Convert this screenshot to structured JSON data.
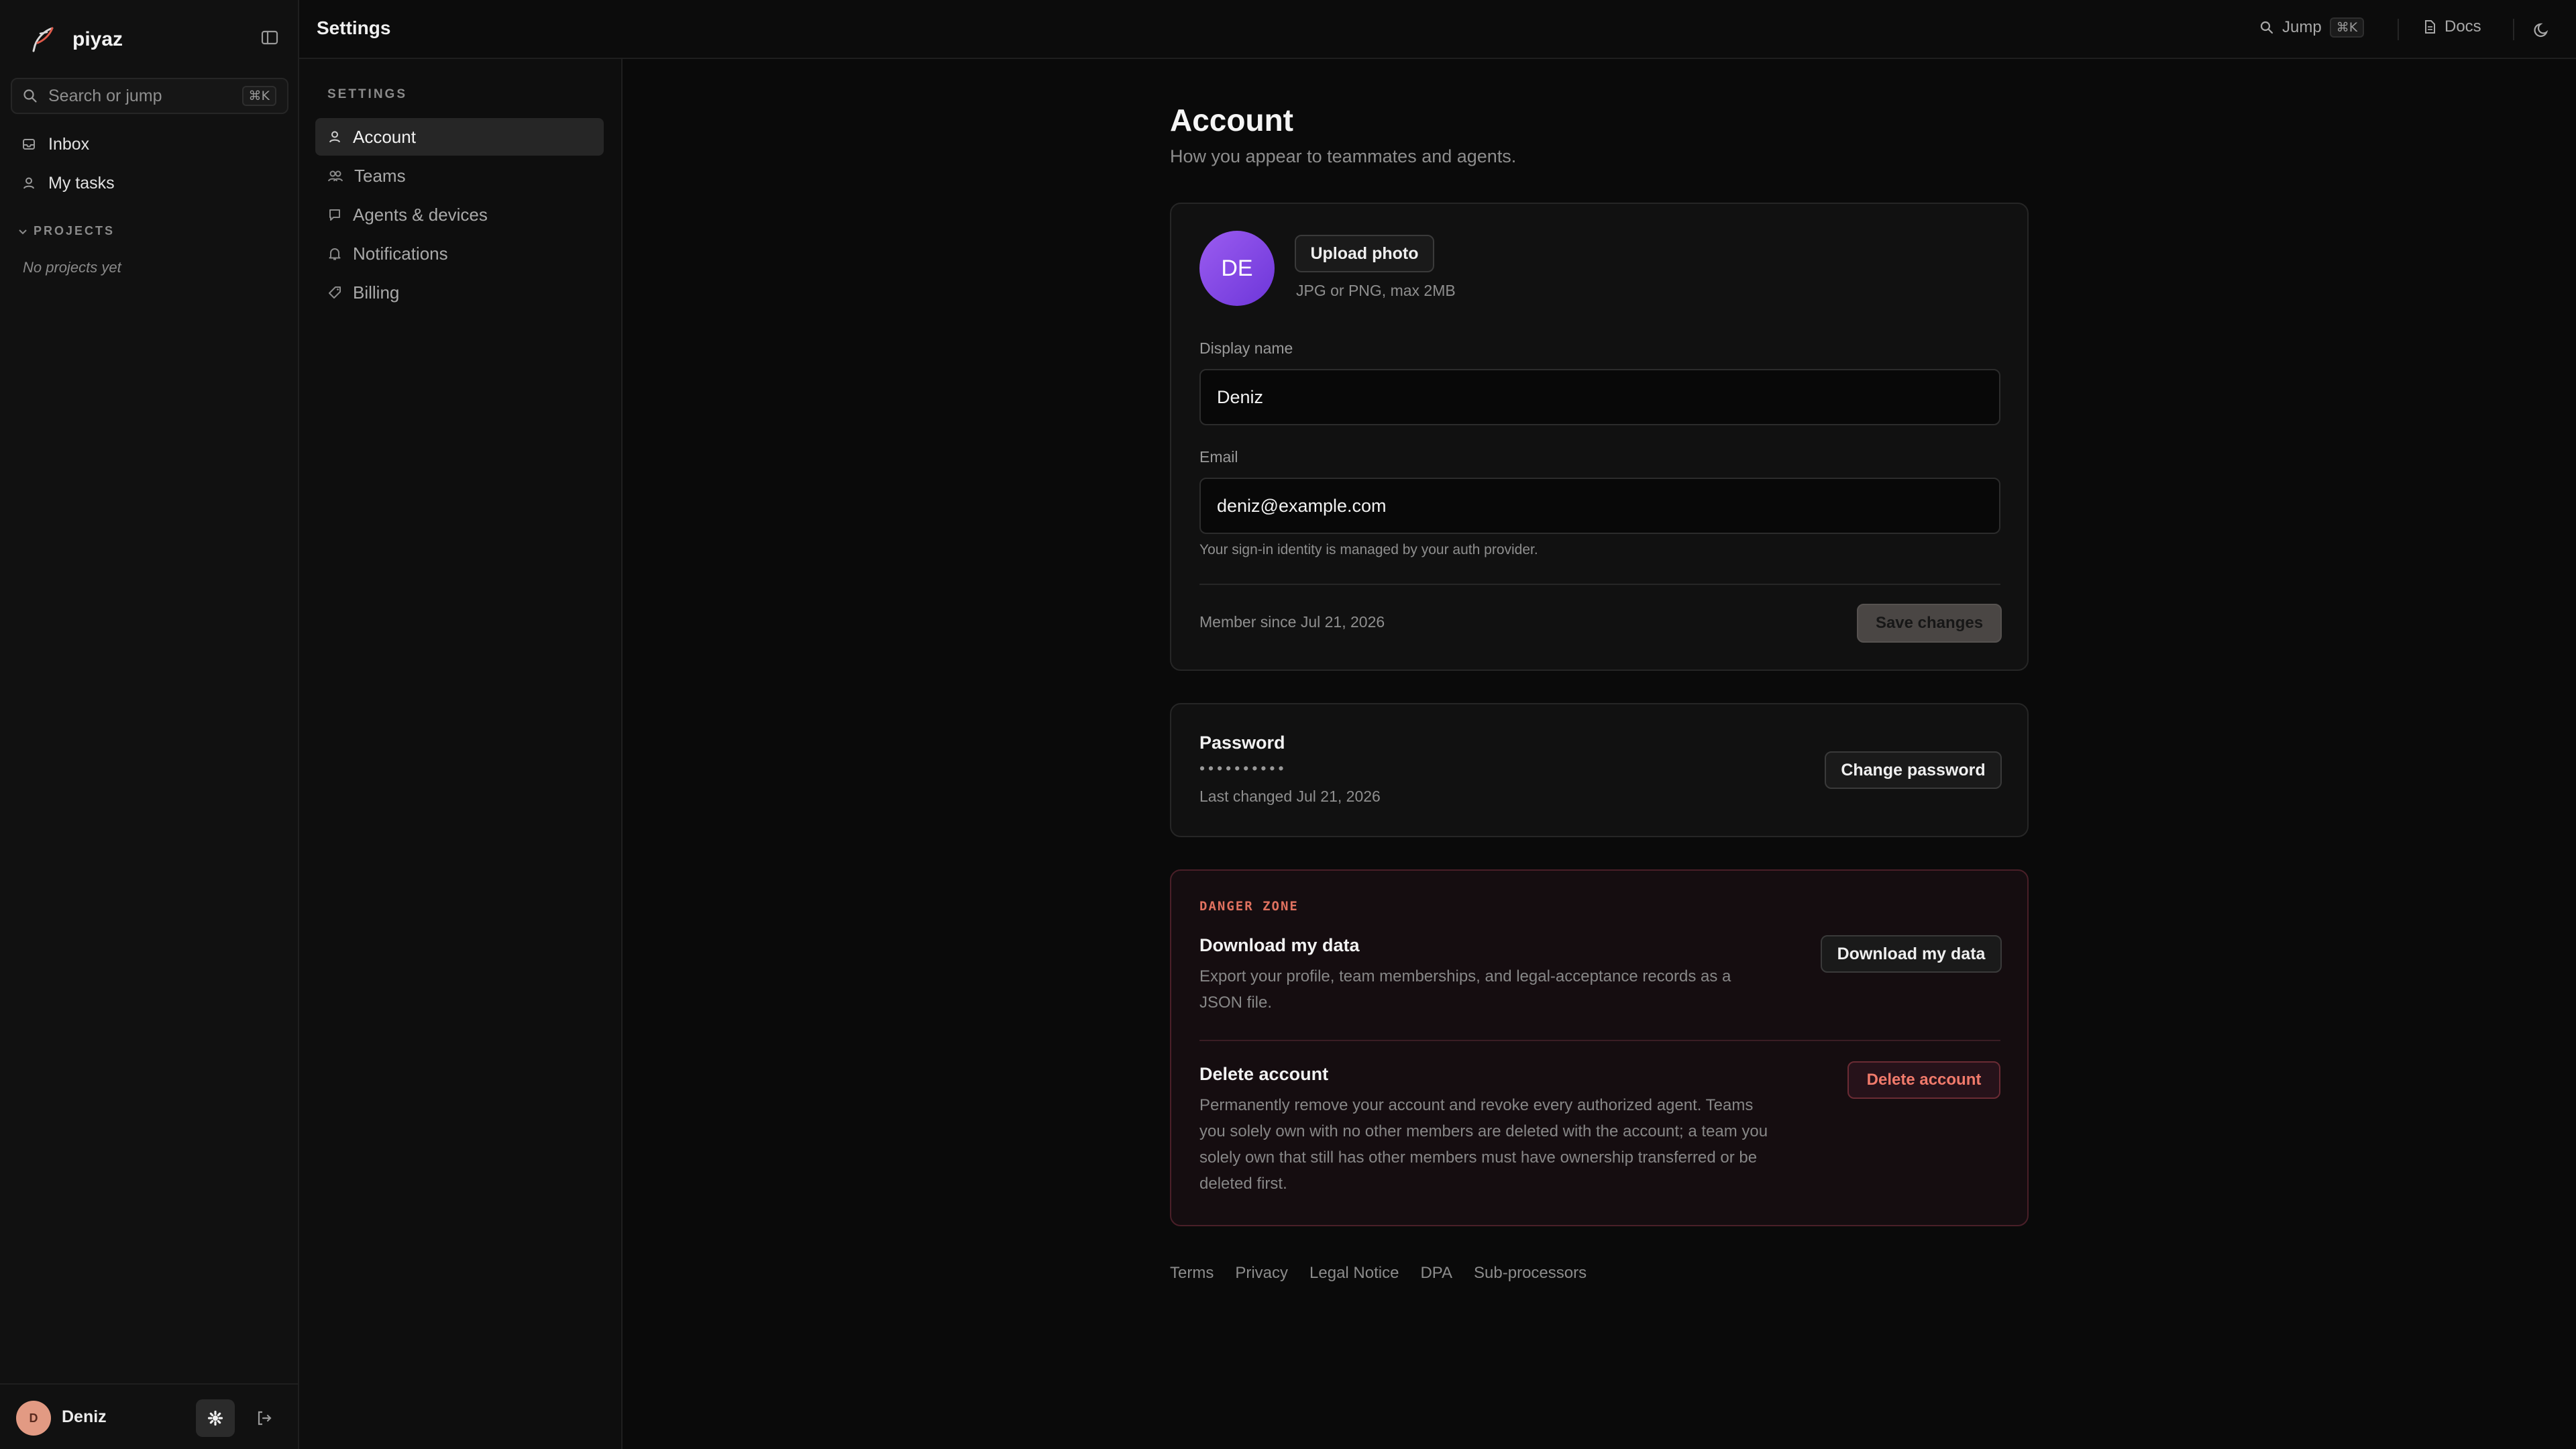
{
  "app": {
    "name": "piyaz"
  },
  "sidebar": {
    "search_placeholder": "Search or jump",
    "search_shortcut": "⌘K",
    "items": [
      {
        "label": "Inbox",
        "icon": "inbox-icon"
      },
      {
        "label": "My tasks",
        "icon": "person-icon"
      }
    ],
    "projects_heading": "PROJECTS",
    "no_projects": "No projects yet",
    "user": {
      "initial": "D",
      "name": "Deniz"
    }
  },
  "topbar": {
    "title": "Settings",
    "jump_label": "Jump",
    "jump_shortcut": "⌘K",
    "docs_label": "Docs"
  },
  "settings_nav": {
    "heading": "SETTINGS",
    "items": [
      {
        "label": "Account",
        "icon": "person-icon",
        "active": true
      },
      {
        "label": "Teams",
        "icon": "people-icon",
        "active": false
      },
      {
        "label": "Agents & devices",
        "icon": "chat-icon",
        "active": false
      },
      {
        "label": "Notifications",
        "icon": "bell-icon",
        "active": false
      },
      {
        "label": "Billing",
        "icon": "tag-icon",
        "active": false
      }
    ]
  },
  "account": {
    "title": "Account",
    "subtitle": "How you appear to teammates and agents.",
    "avatar_initials": "DE",
    "upload_label": "Upload photo",
    "upload_hint": "JPG or PNG, max 2MB",
    "display_name_label": "Display name",
    "display_name_value": "Deniz",
    "email_label": "Email",
    "email_value": "deniz@example.com",
    "email_hint": "Your sign-in identity is managed by your auth provider.",
    "member_since": "Member since Jul 21, 2026",
    "save_label": "Save changes"
  },
  "password": {
    "title": "Password",
    "masked": "••••••••••",
    "last_changed": "Last changed Jul 21, 2026",
    "change_label": "Change password"
  },
  "danger_zone": {
    "heading": "DANGER ZONE",
    "download_title": "Download my data",
    "download_desc_1": "Export your profile, team memberships, and legal-acceptance records as a",
    "download_desc_2": "JSON file.",
    "download_button": "Download my data",
    "delete_title": "Delete account",
    "delete_desc_1": "Permanently remove your account and revoke every authorized agent. Teams",
    "delete_desc_2": "you solely own with no other members are deleted with the account; a team you",
    "delete_desc_3": "solely own that still has other members must have ownership transferred or be",
    "delete_desc_4": "deleted first.",
    "delete_button": "Delete account"
  },
  "footer": {
    "links": [
      "Terms",
      "Privacy",
      "Legal Notice",
      "DPA",
      "Sub-processors"
    ]
  },
  "colors": {
    "background": "#0a0a0a",
    "avatar_purple": "#8248e6",
    "danger_text": "#e0715f",
    "danger_border": "#4a1f28"
  }
}
